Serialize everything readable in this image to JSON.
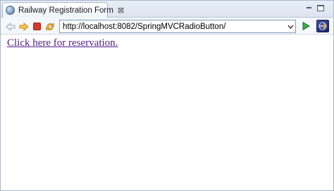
{
  "tab": {
    "title": "Railway Registration Form",
    "close_glyph": "⊠"
  },
  "toolbar": {
    "back_icon": "back-arrow-icon",
    "forward_icon": "forward-arrow-icon",
    "stop_icon": "stop-icon",
    "refresh_icon": "refresh-icon",
    "url": "http://localhost:8082/SpringMVCRadioButton/",
    "go_icon": "go-icon",
    "extension_icon": "eclipse-icon"
  },
  "content": {
    "link_text": "Click here for reservation."
  },
  "colors": {
    "link": "#551a8b",
    "toolbar_bg": "#f4f7fb",
    "stop": "#d63a2a",
    "arrows": "#e8a71c",
    "go": "#2f9b3a"
  }
}
